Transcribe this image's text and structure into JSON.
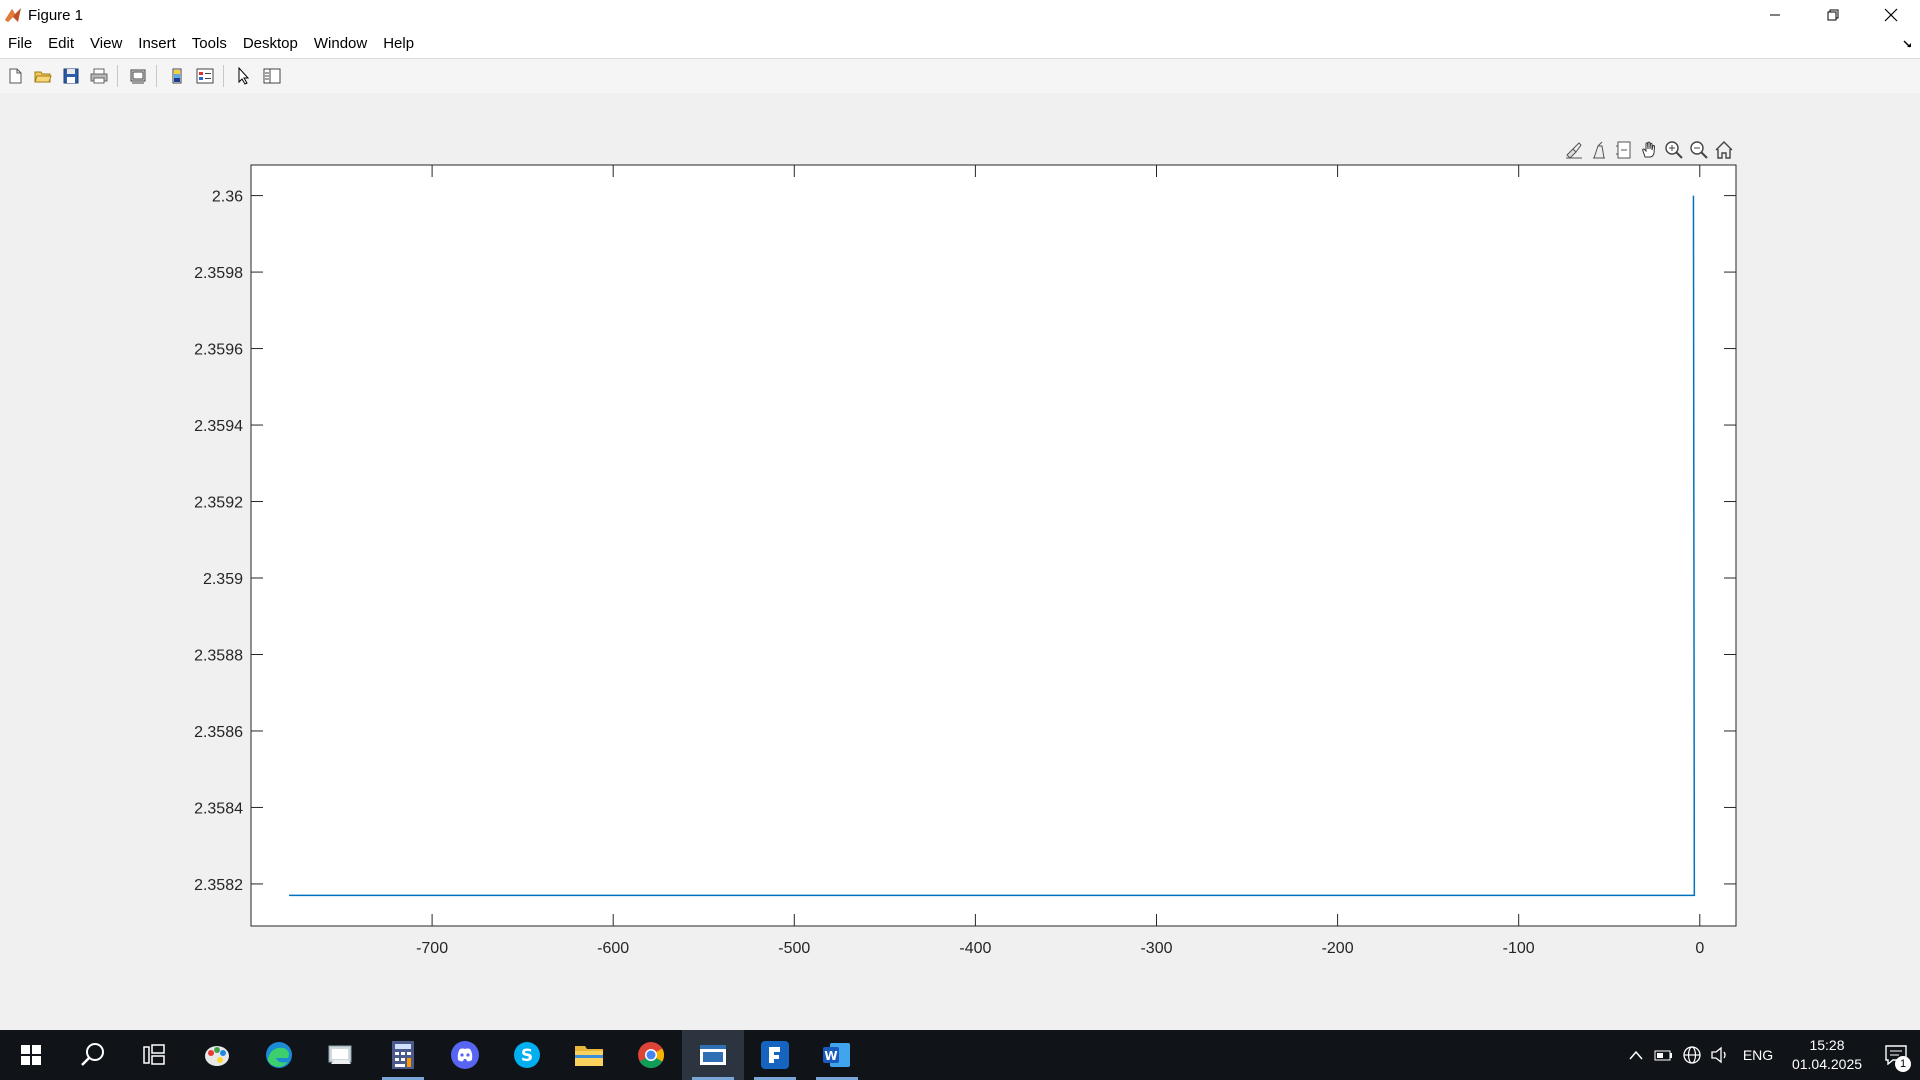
{
  "window": {
    "title": "Figure 1"
  },
  "menu": {
    "items": [
      "File",
      "Edit",
      "View",
      "Insert",
      "Tools",
      "Desktop",
      "Window",
      "Help"
    ]
  },
  "toolbar": {
    "icons": [
      "new-figure-icon",
      "open-file-icon",
      "save-icon",
      "print-icon",
      "print-preview-icon",
      "colorbar-icon",
      "legend-icon",
      "edit-plot-icon",
      "property-inspector-icon"
    ]
  },
  "axes_toolbar": {
    "icons": [
      "brush-icon",
      "data-tips-icon",
      "restore-view-icon",
      "pan-icon",
      "zoom-in-icon",
      "zoom-out-icon",
      "home-icon"
    ]
  },
  "chart_data": {
    "type": "line",
    "xlim": [
      -800,
      20
    ],
    "ylim": [
      2.35809,
      2.36008
    ],
    "xticks": [
      -700,
      -600,
      -500,
      -400,
      -300,
      -200,
      -100,
      0
    ],
    "xtick_labels": [
      "-700",
      "-600",
      "-500",
      "-400",
      "-300",
      "-200",
      "-100",
      "0"
    ],
    "yticks": [
      2.3582,
      2.3584,
      2.3586,
      2.3588,
      2.359,
      2.3592,
      2.3594,
      2.3596,
      2.3598,
      2.36
    ],
    "ytick_labels": [
      "2.3582",
      "2.3584",
      "2.3586",
      "2.3588",
      "2.359",
      "2.3592",
      "2.3594",
      "2.3596",
      "2.3598",
      "2.36"
    ],
    "grid": false,
    "series": [
      {
        "color": "#0072bd",
        "x": [
          -779,
          -3,
          -3.5
        ],
        "y": [
          2.35817,
          2.35817,
          2.36
        ]
      }
    ]
  },
  "taskbar": {
    "apps": [
      "start-icon",
      "search-icon",
      "task-view-icon",
      "paint-icon",
      "edge-icon",
      "explorer-app-icon",
      "calculator-icon",
      "discord-icon",
      "skype-icon",
      "file-explorer-icon",
      "chrome-icon",
      "matlab-window-icon",
      "app-icon",
      "word-icon"
    ],
    "language": "ENG",
    "time": "15:28",
    "date": "01.04.2025",
    "notification_count": "1"
  }
}
